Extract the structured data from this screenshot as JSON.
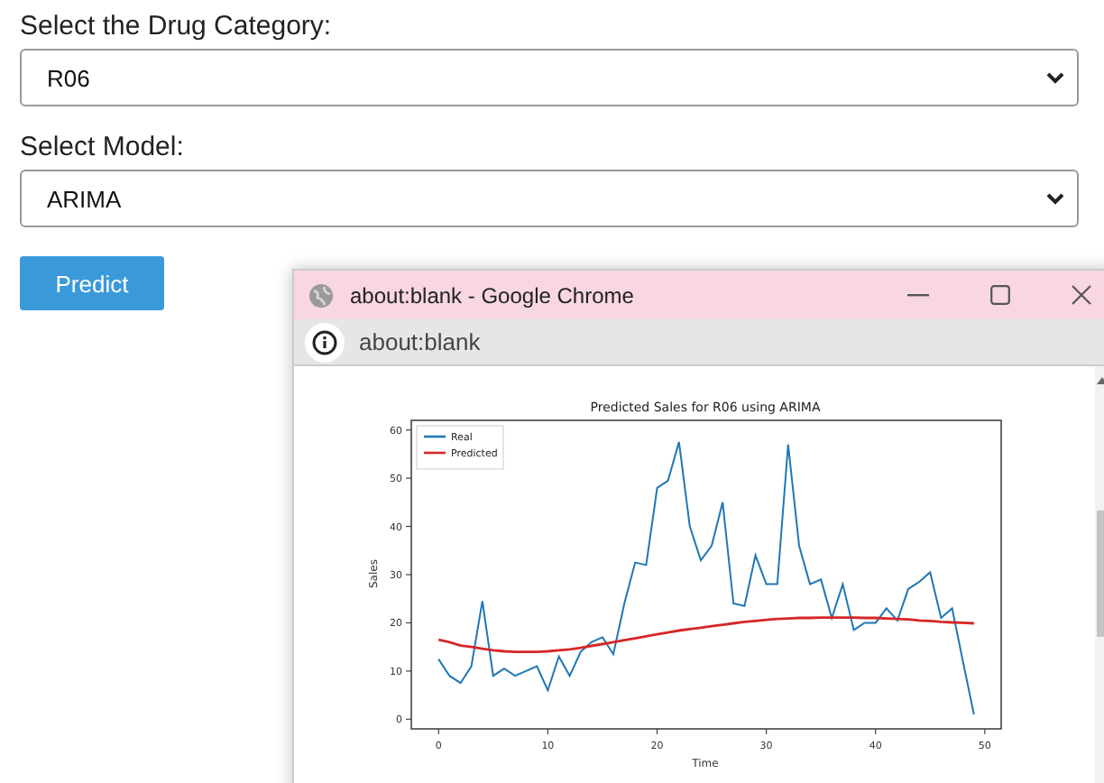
{
  "form": {
    "category_label": "Select the Drug Category:",
    "category_value": "R06",
    "model_label": "Select Model:",
    "model_value": "ARIMA",
    "predict_button": "Predict"
  },
  "popup": {
    "title": "about:blank - Google Chrome",
    "address": "about:blank",
    "chart_data": {
      "type": "line",
      "title": "Predicted Sales for R06 using ARIMA",
      "xlabel": "Time",
      "ylabel": "Sales",
      "legend": "upper left",
      "x": [
        0,
        1,
        2,
        3,
        4,
        5,
        6,
        7,
        8,
        9,
        10,
        11,
        12,
        13,
        14,
        15,
        16,
        17,
        18,
        19,
        20,
        21,
        22,
        23,
        24,
        25,
        26,
        27,
        28,
        29,
        30,
        31,
        32,
        33,
        34,
        35,
        36,
        37,
        38,
        39,
        40,
        41,
        42,
        43,
        44,
        45,
        46,
        47,
        48,
        49
      ],
      "xlim": [
        -2.5,
        51.5
      ],
      "ylim": [
        -2,
        62
      ],
      "xticks": [
        0,
        10,
        20,
        30,
        40,
        50
      ],
      "yticks": [
        0,
        10,
        20,
        30,
        40,
        50,
        60
      ],
      "series": [
        {
          "name": "Real",
          "color": "#1f77b4",
          "values": [
            12.5,
            9,
            7.5,
            11,
            24.5,
            9,
            10.5,
            9,
            10,
            11,
            6,
            13,
            9,
            14,
            16,
            17,
            13.5,
            24,
            32.5,
            32,
            48,
            49.5,
            57.5,
            40,
            33,
            36,
            45,
            24,
            23.5,
            34,
            28,
            28,
            57,
            36,
            28,
            29,
            21,
            28,
            18.5,
            20,
            20,
            23,
            20.5,
            27,
            28.5,
            30.5,
            21,
            23,
            12,
            1
          ]
        },
        {
          "name": "Predicted",
          "color": "#d62728",
          "values": [
            16.5,
            16,
            15.3,
            15,
            14.6,
            14.3,
            14.1,
            14,
            14,
            14,
            14.1,
            14.3,
            14.5,
            14.8,
            15.2,
            15.6,
            16,
            16.4,
            16.8,
            17.2,
            17.6,
            18,
            18.4,
            18.7,
            19,
            19.3,
            19.6,
            19.9,
            20.2,
            20.4,
            20.6,
            20.8,
            20.9,
            21,
            21,
            21.1,
            21.1,
            21.1,
            21.1,
            21,
            21,
            20.9,
            20.8,
            20.7,
            20.5,
            20.4,
            20.2,
            20.1,
            20,
            19.9
          ]
        }
      ]
    }
  }
}
